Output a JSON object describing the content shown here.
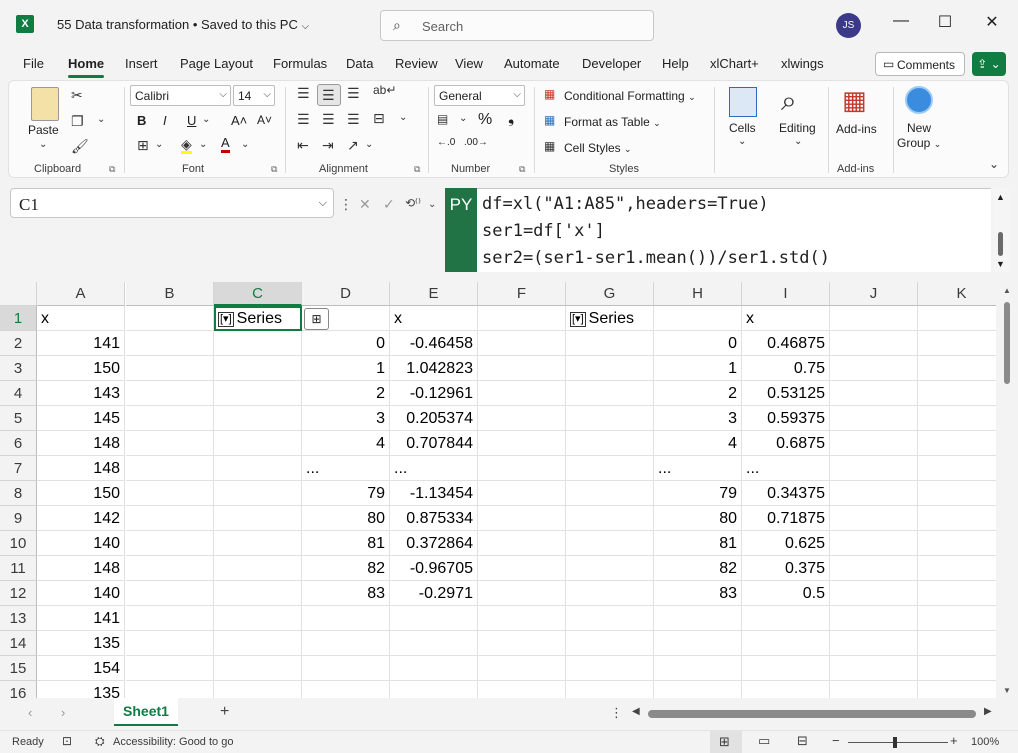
{
  "window": {
    "title": "55 Data transformation • Saved to this PC",
    "search_placeholder": "Search",
    "user_initials": "JS",
    "minimize": "—",
    "maximize": "☐",
    "close": "✕"
  },
  "menu": {
    "items": [
      "File",
      "Home",
      "Insert",
      "Page Layout",
      "Formulas",
      "Data",
      "Review",
      "View",
      "Automate",
      "Developer",
      "Help",
      "xlChart+",
      "xlwings"
    ],
    "active": "Home",
    "comments_label": "Comments"
  },
  "ribbon": {
    "clipboard": {
      "label": "Clipboard",
      "paste": "Paste"
    },
    "font": {
      "label": "Font",
      "family": "Calibri",
      "size": "14",
      "bold": "B",
      "italic": "I",
      "underline": "U"
    },
    "alignment": {
      "label": "Alignment"
    },
    "number": {
      "label": "Number",
      "format": "General",
      "percent": "%"
    },
    "styles": {
      "label": "Styles",
      "conditional": "Conditional Formatting",
      "table": "Format as Table",
      "cell_styles": "Cell Styles"
    },
    "cells": {
      "label": "Cells"
    },
    "editing": {
      "label": "Editing"
    },
    "addins": {
      "label": "Add-ins",
      "button": "Add-ins"
    },
    "newgroup": {
      "line1": "New",
      "line2": "Group"
    }
  },
  "formula_bar": {
    "name_box": "C1",
    "py_badge": "PY",
    "lines": [
      "df=xl(\"A1:A85\",headers=True)",
      "ser1=df['x']",
      "ser2=(ser1-ser1.mean())/ser1.std()"
    ]
  },
  "grid": {
    "columns": [
      "A",
      "B",
      "C",
      "D",
      "E",
      "F",
      "G",
      "H",
      "I",
      "J",
      "K"
    ],
    "selected_column": "C",
    "rows": [
      "1",
      "2",
      "3",
      "4",
      "5",
      "6",
      "7",
      "8",
      "9",
      "10",
      "11",
      "12",
      "13",
      "14",
      "15",
      "16"
    ],
    "colA": [
      "x",
      "141",
      "150",
      "143",
      "145",
      "148",
      "148",
      "150",
      "142",
      "140",
      "148",
      "140",
      "141",
      "135",
      "154",
      "135"
    ],
    "c1_label": "Series",
    "c1_icon": "[▾]",
    "colD": [
      "",
      "0",
      "1",
      "2",
      "3",
      "4",
      "...",
      "79",
      "80",
      "81",
      "82",
      "83"
    ],
    "colE": [
      "x",
      "-0.46458",
      "1.042823",
      "-0.12961",
      "0.205374",
      "0.707844",
      "...",
      "-1.13454",
      "0.875334",
      "0.372864",
      "-0.96705",
      "-0.2971"
    ],
    "g1_label": "Series",
    "g1_icon": "[▾]",
    "colH": [
      "",
      "0",
      "1",
      "2",
      "3",
      "4",
      "...",
      "79",
      "80",
      "81",
      "82",
      "83"
    ],
    "colI": [
      "x",
      "0.46875",
      "0.75",
      "0.53125",
      "0.59375",
      "0.6875",
      "...",
      "0.34375",
      "0.71875",
      "0.625",
      "0.375",
      "0.5"
    ]
  },
  "sheets": {
    "tabs": [
      "Sheet1"
    ],
    "add": "+"
  },
  "status": {
    "ready": "Ready",
    "accessibility": "Accessibility: Good to go",
    "zoom": "100%"
  }
}
